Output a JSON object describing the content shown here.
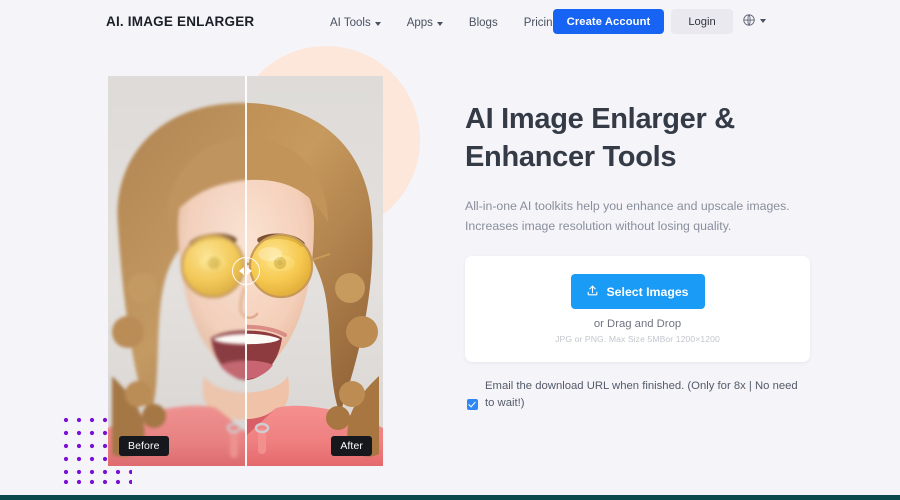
{
  "header": {
    "brand": "AI. IMAGE ENLARGER",
    "nav": [
      {
        "label": "AI Tools",
        "has_caret": true
      },
      {
        "label": "Apps",
        "has_caret": true
      },
      {
        "label": "Blogs",
        "has_caret": false
      },
      {
        "label": "Pricing",
        "has_caret": false
      }
    ],
    "create_account_label": "Create Account",
    "login_label": "Login",
    "language_icon": "globe-language-icon"
  },
  "hero": {
    "title_line1": "AI Image Enlarger &",
    "title_line2": "Enhancer Tools",
    "subtitle_line1": "All-in-one AI toolkits help you enhance and upscale images.",
    "subtitle_line2": "Increases image resolution without losing quality."
  },
  "upload": {
    "select_label": "Select Images",
    "upload_icon": "upload-icon",
    "drag_text": "or Drag and Drop",
    "meta_text": "JPG or PNG. Max Size 5MBor 1200×1200"
  },
  "email_option": {
    "checked": true,
    "text": "Email the download URL when finished. (Only for 8x | No need to wait!)"
  },
  "comparison": {
    "before_label": "Before",
    "after_label": "After",
    "handle_icon": "slider-handle-icon",
    "alt": "Portrait of a smiling woman with curly hair and yellow round sunglasses wearing a pink hoodie"
  },
  "decor": {
    "peach_circle_color": "#fde7db",
    "dot_color": "#7a0fd6",
    "footer_bar_color": "#0b4a4c",
    "page_background": "#f4f4f9"
  }
}
